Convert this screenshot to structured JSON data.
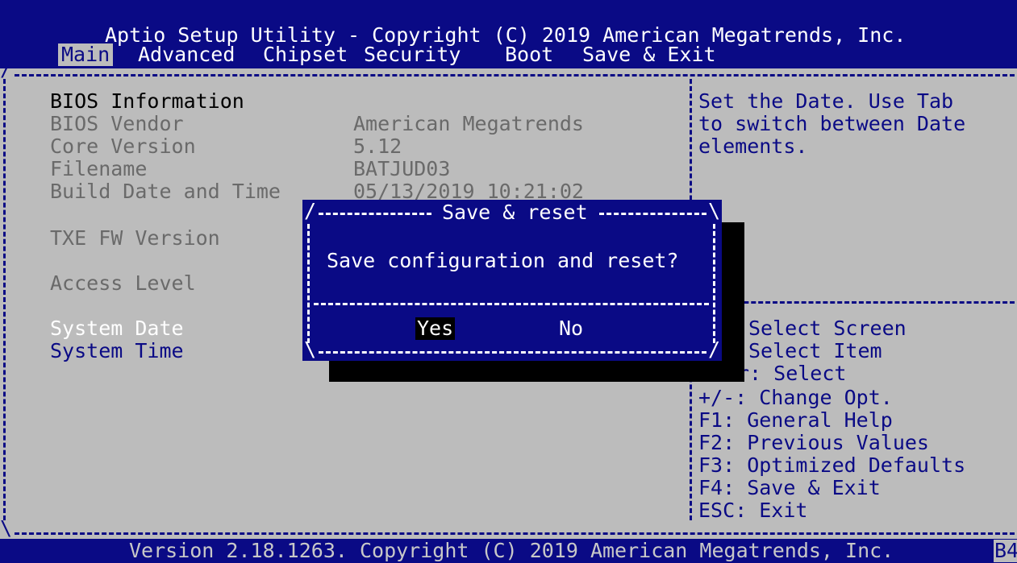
{
  "header": {
    "title": "Aptio Setup Utility - Copyright (C) 2019 American Megatrends, Inc.",
    "tabs": [
      {
        "label": "Main",
        "active": true
      },
      {
        "label": "Advanced",
        "active": false
      },
      {
        "label": "Chipset",
        "active": false
      },
      {
        "label": "Security",
        "active": false
      },
      {
        "label": "Boot",
        "active": false
      },
      {
        "label": "Save & Exit",
        "active": false
      }
    ]
  },
  "main": {
    "bios_information": "BIOS Information",
    "rows": [
      {
        "label": "BIOS Vendor",
        "value": "American Megatrends"
      },
      {
        "label": "Core Version",
        "value": "5.12"
      },
      {
        "label": "Filename",
        "value": "BATJUD03"
      },
      {
        "label": "Build Date and Time",
        "value": "05/13/2019 10:21:02"
      }
    ],
    "txe_fw_version": "TXE FW Version",
    "access_level": "Access Level",
    "system_date": "System Date",
    "system_time": "System Time"
  },
  "help": {
    "lines": [
      "Set the Date. Use Tab",
      "to switch between Date",
      "elements."
    ],
    "keys": [
      "Select Screen",
      "Select Item",
      "r: Select",
      "+/-: Change Opt.",
      "F1: General Help",
      "F2: Previous Values",
      "F3: Optimized Defaults",
      "F4: Save & Exit",
      "ESC: Exit"
    ]
  },
  "dialog": {
    "title": "Save & reset",
    "message": "Save configuration and reset?",
    "yes": "Yes",
    "no": "No"
  },
  "footer": {
    "version": "Version 2.18.1263. Copyright (C) 2019 American Megatrends, Inc.",
    "code": "B4"
  },
  "colors": {
    "header_bg": "#0a0a85",
    "body_bg": "#bcbcbc",
    "dialog_bg": "#0a0a85"
  }
}
